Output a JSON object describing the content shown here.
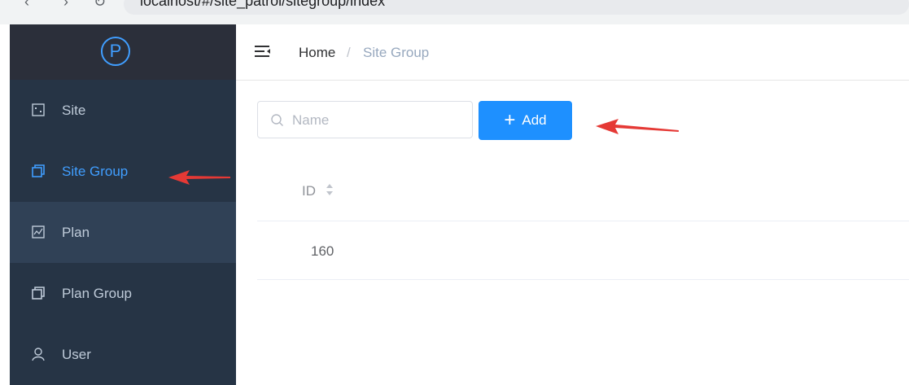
{
  "browser": {
    "url": "localhost/#/site_patrol/sitegroup/index"
  },
  "sidebar": {
    "logo_letter": "P",
    "items": [
      {
        "label": "Site"
      },
      {
        "label": "Site Group"
      },
      {
        "label": "Plan"
      },
      {
        "label": "Plan Group"
      },
      {
        "label": "User"
      }
    ]
  },
  "header": {
    "breadcrumb_home": "Home",
    "breadcrumb_sep": "/",
    "breadcrumb_current": "Site Group"
  },
  "toolbar": {
    "search_placeholder": "Name",
    "search_value": "",
    "add_label": "Add",
    "add_plus": "+"
  },
  "table": {
    "columns": [
      "ID"
    ],
    "rows": [
      {
        "id": "160"
      }
    ]
  },
  "colors": {
    "accent": "#409eff",
    "primary_button": "#1e90ff",
    "sidebar_bg": "#304156",
    "annotation_arrow": "#e53935"
  },
  "icons": [
    "logo-p-icon",
    "hamburger-icon",
    "search-icon",
    "site-icon",
    "site-group-icon",
    "plan-icon",
    "plan-group-icon",
    "user-icon",
    "sort-caret-icon"
  ]
}
